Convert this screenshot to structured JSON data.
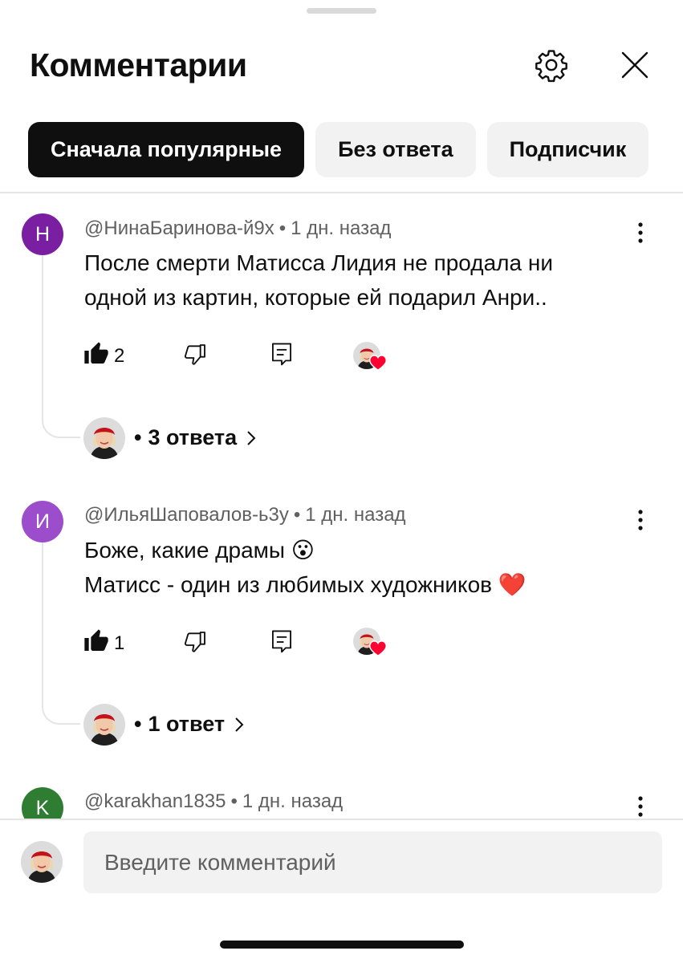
{
  "header": {
    "title": "Комментарии",
    "settings_icon": "gear-icon",
    "close_icon": "close-icon"
  },
  "filters": [
    {
      "label": "Сначала популярные",
      "active": true
    },
    {
      "label": "Без ответа",
      "active": false
    },
    {
      "label": "Подписчик",
      "active": false
    }
  ],
  "comments": [
    {
      "initial": "Н",
      "avatar_color": "#7b1fa2",
      "author": "@НинаБаринова-й9х",
      "time": "1 дн. назад",
      "lines": [
        "После смерти Матисса Лидия не продала ни",
        "одной из картин, которые ей подарил Анри.."
      ],
      "likes": "2",
      "replies": "3 ответа"
    },
    {
      "initial": "И",
      "avatar_color": "#9c4dcc",
      "author": "@ИльяШаповалов-ь3у",
      "time": "1 дн. назад",
      "lines": [
        "Боже, какие драмы 😮",
        "Матисс - один из любимых художников ❤️"
      ],
      "likes": "1",
      "replies": "1 ответ"
    },
    {
      "initial": "K",
      "avatar_color": "#2e7d32",
      "author": "@karakhan1835",
      "time": "1 дн. назад"
    }
  ],
  "separator": "•",
  "composer": {
    "placeholder": "Введите комментарий"
  },
  "colors": {
    "accent_dark": "#0f0f0f",
    "chip_bg": "#f2f2f2",
    "secondary_text": "#606060",
    "heart": "#ff0033"
  }
}
